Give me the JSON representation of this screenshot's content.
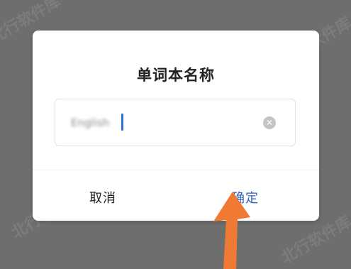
{
  "dialog": {
    "title": "单词本名称",
    "input": {
      "value": "English"
    },
    "cancel_label": "取消",
    "confirm_label": "确定"
  },
  "watermarks": [
    "北行软件库",
    "北行软件库",
    "北行软件库",
    "北行软件库"
  ],
  "annotation": {
    "icon": "arrow-icon",
    "color": "#f07a34"
  }
}
